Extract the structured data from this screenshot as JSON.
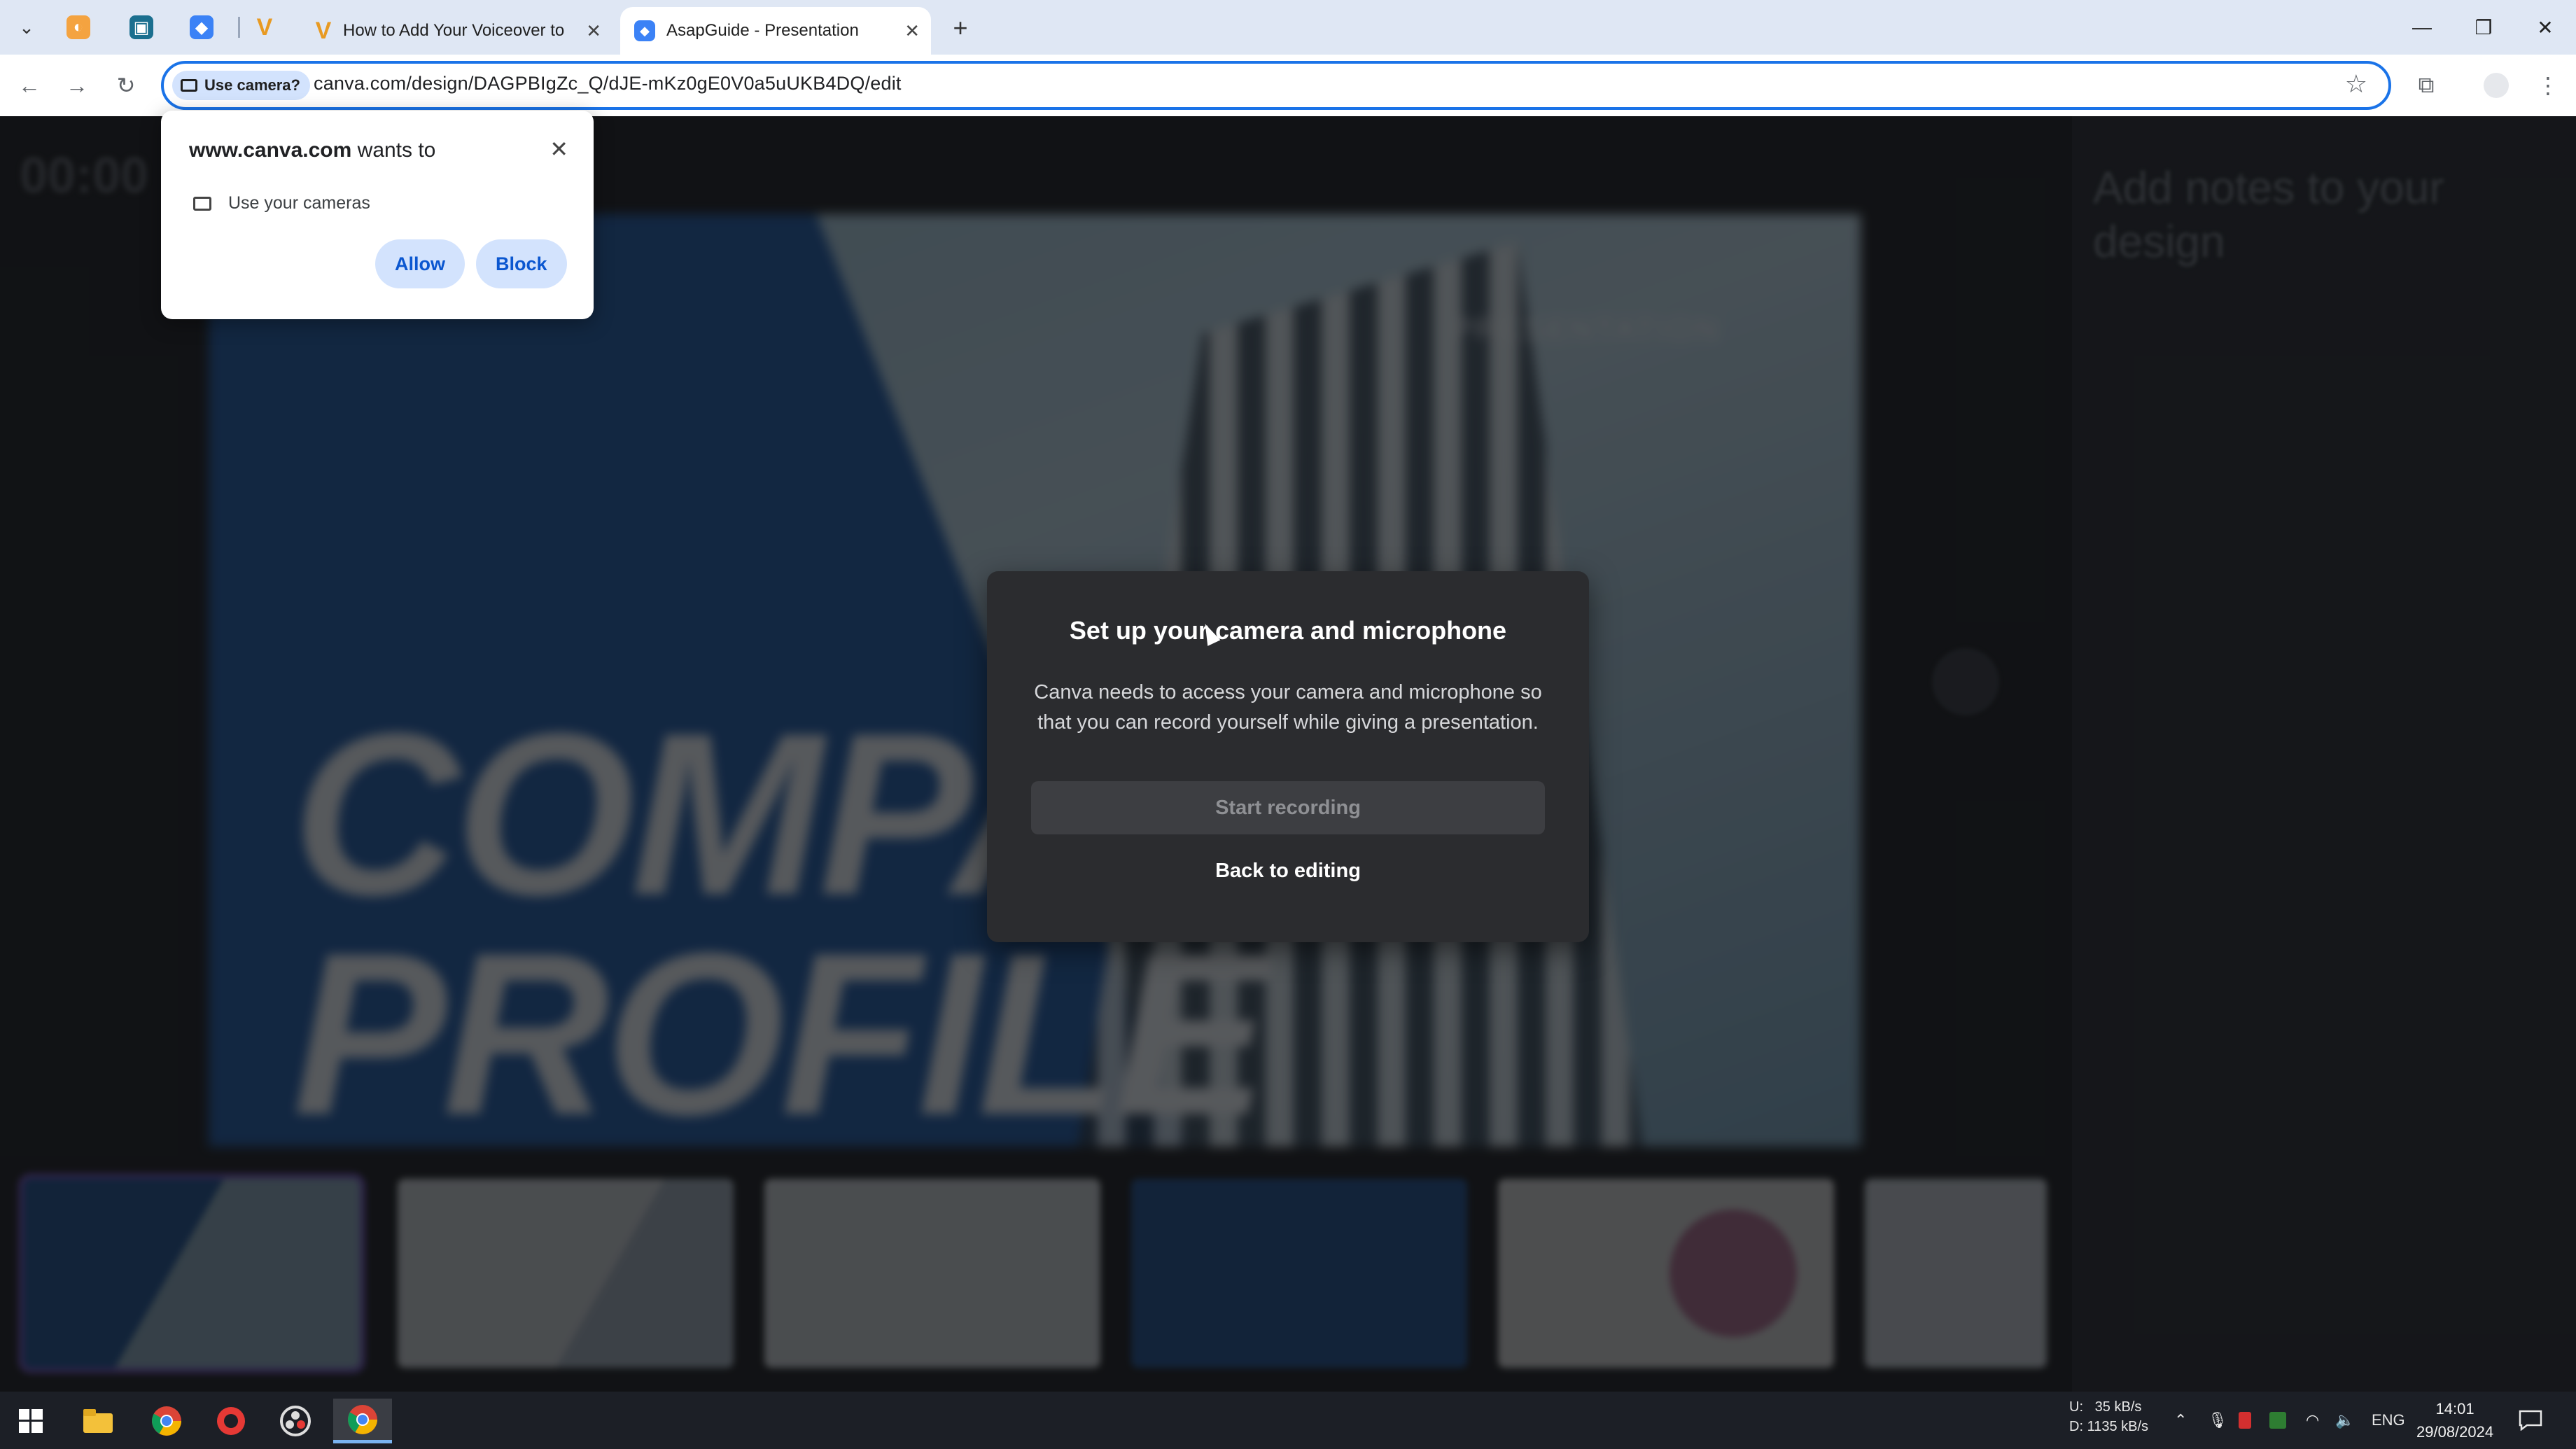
{
  "browser": {
    "tabs": [
      {
        "title": "How to Add Your Voiceover to",
        "favicon": "v-icon"
      },
      {
        "title": "AsapGuide - Presentation",
        "favicon": "asapguide-icon",
        "active": true
      }
    ],
    "url": "canva.com/design/DAGPBIgZc_Q/dJE-mKz0gE0V0a5uUKB4DQ/edit",
    "camera_chip": "Use camera?",
    "accent": "#1a73e8"
  },
  "permission": {
    "site": "www.canva.com",
    "suffix": " wants to",
    "item": "Use your cameras",
    "allow": "Allow",
    "block": "Block"
  },
  "presenter": {
    "timer": "00:00",
    "notes_placeholder": "Add notes to your design",
    "slide_title_line1": "COMPANY",
    "slide_title_line2": "PROFILE",
    "slide_tag": "PRESENTATION"
  },
  "modal": {
    "title": "Set up your camera and microphone",
    "body": "Canva needs to access your camera and microphone so that you can record yourself while giving a presentation.",
    "start": "Start recording",
    "back": "Back to editing"
  },
  "taskbar": {
    "net_up": "U:",
    "net_up_val": "35 kB/s",
    "net_down": "D:",
    "net_down_val": "1135 kB/s",
    "lang": "ENG",
    "time": "14:01",
    "date": "29/08/2024"
  }
}
